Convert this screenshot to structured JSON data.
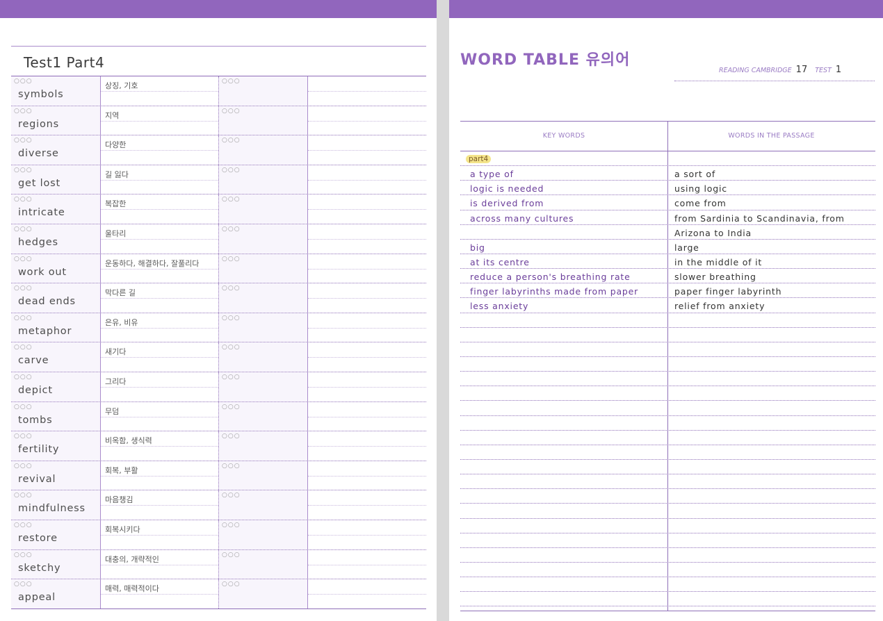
{
  "left_page": {
    "title": "Test1  Part4",
    "circles": "○○○",
    "rows": [
      {
        "word": "symbols",
        "meaning": "상징, 기호"
      },
      {
        "word": "regions",
        "meaning": "지역"
      },
      {
        "word": "diverse",
        "meaning": "다양한"
      },
      {
        "word": "get lost",
        "meaning": "길 잃다"
      },
      {
        "word": "intricate",
        "meaning": "복잡한"
      },
      {
        "word": "hedges",
        "meaning": "울타리"
      },
      {
        "word": "work out",
        "meaning": "운동하다, 해결하다, 잘풀리다"
      },
      {
        "word": "dead ends",
        "meaning": "막다른 길"
      },
      {
        "word": "metaphor",
        "meaning": "은유, 비유"
      },
      {
        "word": "carve",
        "meaning": "새기다"
      },
      {
        "word": "depict",
        "meaning": "그리다"
      },
      {
        "word": "tombs",
        "meaning": "무덤"
      },
      {
        "word": "fertility",
        "meaning": "비옥함, 생식력"
      },
      {
        "word": "revival",
        "meaning": "회복, 부활"
      },
      {
        "word": "mindfulness",
        "meaning": "마음챙김"
      },
      {
        "word": "restore",
        "meaning": "회복시키다"
      },
      {
        "word": "sketchy",
        "meaning": "대충의, 개략적인"
      },
      {
        "word": "appeal",
        "meaning": "매력, 매력적이다"
      }
    ]
  },
  "right_page": {
    "title": "WORD TABLE 유의어",
    "ref": {
      "reading_label": "READING CAMBRIDGE",
      "book": "17",
      "test_label": "TEST",
      "test_no": "1"
    },
    "headers": {
      "key_words": "KEY WORDS",
      "passage_words": "WORDS IN THE PASSAGE"
    },
    "part_label": "part4",
    "entries": [
      {
        "key": "a type of",
        "passage": "a sort of"
      },
      {
        "key": "logic is needed",
        "passage": "using logic"
      },
      {
        "key": "is derived from",
        "passage": "come from"
      },
      {
        "key": "across many cultures",
        "passage": "from Sardinia to Scandinavia, from"
      },
      {
        "key": "",
        "passage": "Arizona to India"
      },
      {
        "key": "big",
        "passage": "large"
      },
      {
        "key": "at its centre",
        "passage": "in the middle of it"
      },
      {
        "key": "reduce a person's breathing rate",
        "passage": "slower breathing"
      },
      {
        "key": "finger labyrinths made from paper",
        "passage": "paper finger labyrinth"
      },
      {
        "key": "less anxiety",
        "passage": "relief from anxiety"
      }
    ]
  },
  "colors": {
    "accent": "#9166bd",
    "highlight": "#f4e48a",
    "key_ink": "#6a3d9a"
  }
}
